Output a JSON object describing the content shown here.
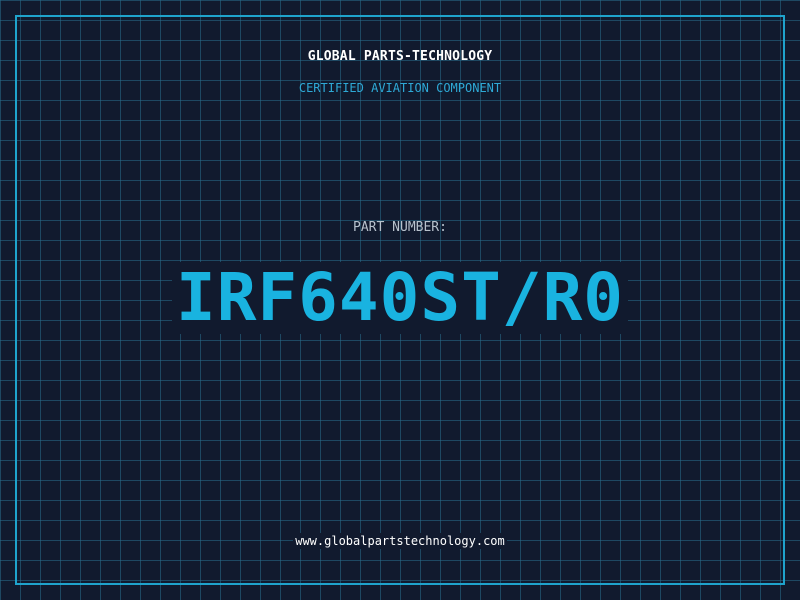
{
  "header": {
    "brand": "GLOBAL PARTS-TECHNOLOGY",
    "subtitle": "CERTIFIED AVIATION COMPONENT"
  },
  "part": {
    "label": "PART NUMBER:",
    "number": "IRF640ST/R0"
  },
  "footer": {
    "website": "www.globalpartstechnology.com"
  },
  "colors": {
    "background": "#111a2e",
    "grid": "#286e8c",
    "accent": "#1fa3cc",
    "part_number": "#19b3e0",
    "label": "#b7c1cc",
    "text": "#ffffff"
  }
}
